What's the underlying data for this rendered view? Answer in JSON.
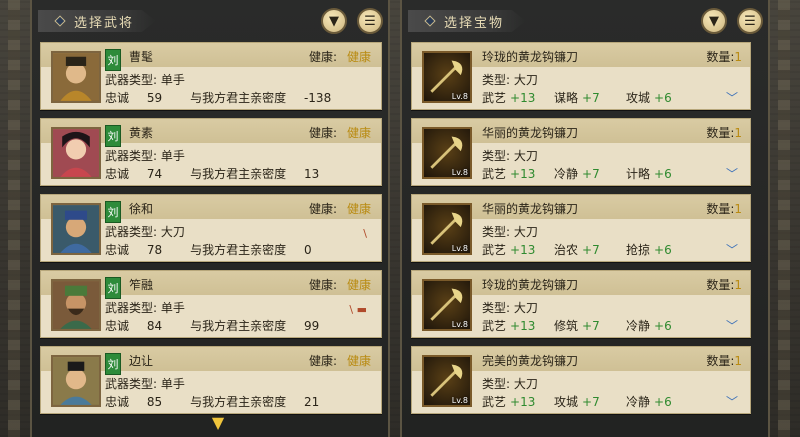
{
  "left_panel": {
    "title": "选择武将",
    "filter_icon": "filter-icon",
    "list_icon": "list-icon",
    "generals": [
      {
        "faction": "刘",
        "name": "曹髦",
        "health_label": "健康:",
        "health": "健康",
        "weapon_type_label": "武器类型:",
        "weapon_type": "单手",
        "loyalty_label": "忠诚",
        "loyalty": "59",
        "intimacy_label": "与我方君主亲密度",
        "intimacy": "-138",
        "weapon_mark": ""
      },
      {
        "faction": "刘",
        "name": "黄素",
        "health_label": "健康:",
        "health": "健康",
        "weapon_type_label": "武器类型:",
        "weapon_type": "单手",
        "loyalty_label": "忠诚",
        "loyalty": "74",
        "intimacy_label": "与我方君主亲密度",
        "intimacy": "13",
        "weapon_mark": ""
      },
      {
        "faction": "刘",
        "name": "徐和",
        "health_label": "健康:",
        "health": "健康",
        "weapon_type_label": "武器类型:",
        "weapon_type": "大刀",
        "loyalty_label": "忠诚",
        "loyalty": "78",
        "intimacy_label": "与我方君主亲密度",
        "intimacy": "0",
        "weapon_mark": "\\"
      },
      {
        "faction": "刘",
        "name": "笮融",
        "health_label": "健康:",
        "health": "健康",
        "weapon_type_label": "武器类型:",
        "weapon_type": "单手",
        "loyalty_label": "忠诚",
        "loyalty": "84",
        "intimacy_label": "与我方君主亲密度",
        "intimacy": "99",
        "weapon_mark": "\\ ▬"
      },
      {
        "faction": "刘",
        "name": "边让",
        "health_label": "健康:",
        "health": "健康",
        "weapon_type_label": "武器类型:",
        "weapon_type": "单手",
        "loyalty_label": "忠诚",
        "loyalty": "85",
        "intimacy_label": "与我方君主亲密度",
        "intimacy": "21",
        "weapon_mark": ""
      }
    ]
  },
  "right_panel": {
    "title": "选择宝物",
    "filter_icon": "filter-icon",
    "list_icon": "list-icon",
    "items": [
      {
        "name": "玲珑的黄龙钩镰刀",
        "qty_label": "数量:",
        "qty": "1",
        "type_label": "类型:",
        "type": "大刀",
        "level": "Lv.8",
        "stats": [
          {
            "label": "武艺",
            "value": "+13"
          },
          {
            "label": "谋略",
            "value": "+7"
          },
          {
            "label": "攻城",
            "value": "+6"
          }
        ]
      },
      {
        "name": "华丽的黄龙钩镰刀",
        "qty_label": "数量:",
        "qty": "1",
        "type_label": "类型:",
        "type": "大刀",
        "level": "Lv.8",
        "stats": [
          {
            "label": "武艺",
            "value": "+13"
          },
          {
            "label": "冷静",
            "value": "+7"
          },
          {
            "label": "计略",
            "value": "+6"
          }
        ]
      },
      {
        "name": "华丽的黄龙钩镰刀",
        "qty_label": "数量:",
        "qty": "1",
        "type_label": "类型:",
        "type": "大刀",
        "level": "Lv.8",
        "stats": [
          {
            "label": "武艺",
            "value": "+13"
          },
          {
            "label": "治农",
            "value": "+7"
          },
          {
            "label": "抢掠",
            "value": "+6"
          }
        ]
      },
      {
        "name": "玲珑的黄龙钩镰刀",
        "qty_label": "数量:",
        "qty": "1",
        "type_label": "类型:",
        "type": "大刀",
        "level": "Lv.8",
        "stats": [
          {
            "label": "武艺",
            "value": "+13"
          },
          {
            "label": "修筑",
            "value": "+7"
          },
          {
            "label": "冷静",
            "value": "+6"
          }
        ]
      },
      {
        "name": "完美的黄龙钩镰刀",
        "qty_label": "数量:",
        "qty": "1",
        "type_label": "类型:",
        "type": "大刀",
        "level": "Lv.8",
        "stats": [
          {
            "label": "武艺",
            "value": "+13"
          },
          {
            "label": "攻城",
            "value": "+7"
          },
          {
            "label": "冷静",
            "value": "+6"
          }
        ]
      }
    ]
  },
  "scroll_indicator": "chevron-down-icon",
  "colors": {
    "health": "#b98b12",
    "stat_value": "#2f8a2f",
    "faction": "#2e8b3a",
    "expand": "#3a6fb8"
  }
}
